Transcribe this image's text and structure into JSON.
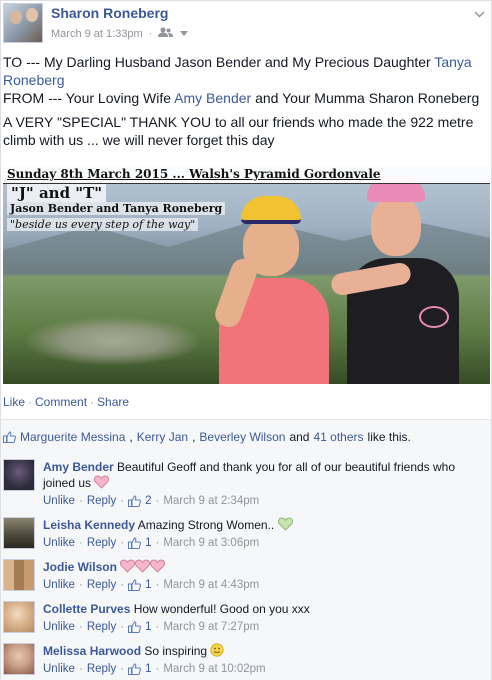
{
  "post": {
    "author": "Sharon Roneberg",
    "timestamp": "March 9 at 1:33pm",
    "privacy_icon": "friends-icon",
    "line1_prefix": "TO --- My Darling Husband Jason Bender and My Precious Daughter ",
    "line1_link": "Tanya Roneberg",
    "line2_prefix": "FROM --- Your Loving Wife ",
    "line2_link": "Amy Bender",
    "line2_suffix": " and Your Mumma Sharon Roneberg",
    "line3": "A VERY \"SPECIAL\" THANK YOU to all our friends who made the 922 metre climb with us ... we will never forget this day"
  },
  "photo": {
    "banner_date": "Sunday 8th March 2015 ... ",
    "banner_place": "Walsh's Pyramid Gordonvale",
    "jt_text": "\"J\" and \"T\"",
    "names_text": "Jason Bender and Tanya Roneberg",
    "quote_text": "\"beside us every step of the way\""
  },
  "actions": {
    "like": "Like",
    "comment": "Comment",
    "share": "Share",
    "sep": "·"
  },
  "likes": {
    "name1": "Marguerite Messina",
    "sep1": ",",
    "name2": "Kerry Jan",
    "sep2": ",",
    "name3": "Beverley Wilson",
    "and": "and",
    "others": "41 others",
    "suffix": "like this."
  },
  "comments": [
    {
      "name": "Amy Bender",
      "text": "Beautiful Geoff and thank you for all of our beautiful friends who joined us",
      "unlike": "Unlike",
      "reply": "Reply",
      "likes": "2",
      "time": "March 9 at 2:34pm",
      "sep": "·",
      "avatar_color": "#2b2b3a",
      "heart_color": "#f4b6c8"
    },
    {
      "name": "Leisha Kennedy",
      "text": "Amazing Strong Women..",
      "unlike": "Unlike",
      "reply": "Reply",
      "likes": "1",
      "time": "March 9 at 3:06pm",
      "sep": "·",
      "avatar_color": "#5e5a4a",
      "heart_color": "#c6e3b0"
    },
    {
      "name": "Jodie Wilson",
      "text": "",
      "unlike": "Unlike",
      "reply": "Reply",
      "likes": "1",
      "time": "March 9 at 4:43pm",
      "sep": "·",
      "avatar_color": "#8a6a4a",
      "heart_color": "#f4b6c8"
    },
    {
      "name": "Collette Purves",
      "text": "How wonderful! Good on you xxx",
      "unlike": "Unlike",
      "reply": "Reply",
      "likes": "1",
      "time": "March 9 at 7:27pm",
      "sep": "·",
      "avatar_color": "#d9b48c"
    },
    {
      "name": "Melissa Harwood",
      "text": "So inspiring",
      "unlike": "Unlike",
      "reply": "Reply",
      "likes": "1",
      "time": "March 9 at 10:02pm",
      "sep": "·",
      "avatar_color": "#c9a08a",
      "emoji_color": "#f6d54a"
    }
  ]
}
